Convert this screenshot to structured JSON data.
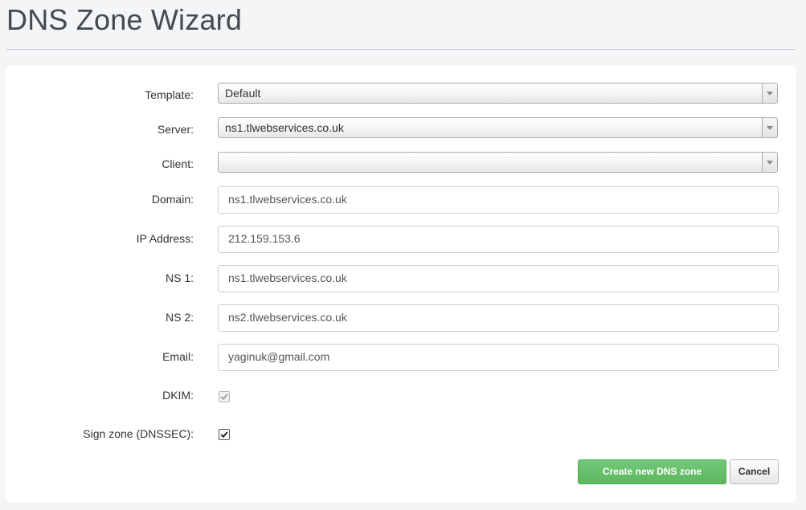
{
  "page": {
    "title": "DNS Zone Wizard"
  },
  "form": {
    "template": {
      "label": "Template:",
      "value": "Default"
    },
    "server": {
      "label": "Server:",
      "value": "ns1.tlwebservices.co.uk"
    },
    "client": {
      "label": "Client:",
      "value": ""
    },
    "domain": {
      "label": "Domain:",
      "value": "ns1.tlwebservices.co.uk"
    },
    "ip_address": {
      "label": "IP Address:",
      "value": "212.159.153.6"
    },
    "ns1": {
      "label": "NS 1:",
      "value": "ns1.tlwebservices.co.uk"
    },
    "ns2": {
      "label": "NS 2:",
      "value": "ns2.tlwebservices.co.uk"
    },
    "email": {
      "label": "Email:",
      "value": "yaginuk@gmail.com"
    },
    "dkim": {
      "label": "DKIM:",
      "checked": true,
      "disabled": true
    },
    "sign_zone": {
      "label": "Sign zone (DNSSEC):",
      "checked": true,
      "disabled": false
    }
  },
  "actions": {
    "create_label": "Create new DNS zone",
    "cancel_label": "Cancel"
  },
  "colors": {
    "primary_button": "#5cb85c",
    "page_background": "#f3f5f7"
  }
}
